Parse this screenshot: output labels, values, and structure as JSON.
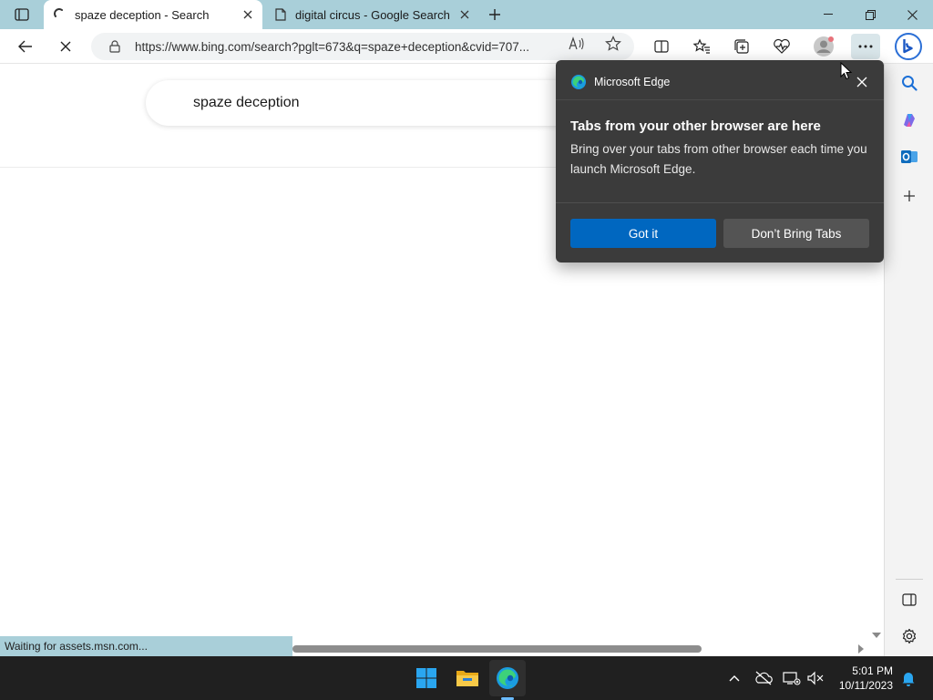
{
  "browser": {
    "tabs": [
      {
        "title": "spaze deception - Search",
        "active": true,
        "loading": true
      },
      {
        "title": "digital circus - Google Search",
        "active": false
      }
    ],
    "address_url": "https://www.bing.com/search?pglt=673&q=spaze+deception&cvid=707..."
  },
  "page": {
    "search_query": "spaze deception",
    "status_text": "Waiting for assets.msn.com..."
  },
  "popup": {
    "app_name": "Microsoft Edge",
    "title": "Tabs from your other browser are here",
    "body": "Bring over your tabs from other browser each time you launch Microsoft Edge.",
    "primary_button": "Got it",
    "secondary_button": "Don’t Bring Tabs"
  },
  "taskbar": {
    "time": "5:01 PM",
    "date": "10/11/2023",
    "apps": [
      "windows-start",
      "file-explorer",
      "microsoft-edge"
    ]
  },
  "colors": {
    "tabstrip": "#a9cfd9",
    "popup_bg": "#3b3b3b",
    "primary_button": "#0067c0",
    "taskbar": "#202020"
  }
}
